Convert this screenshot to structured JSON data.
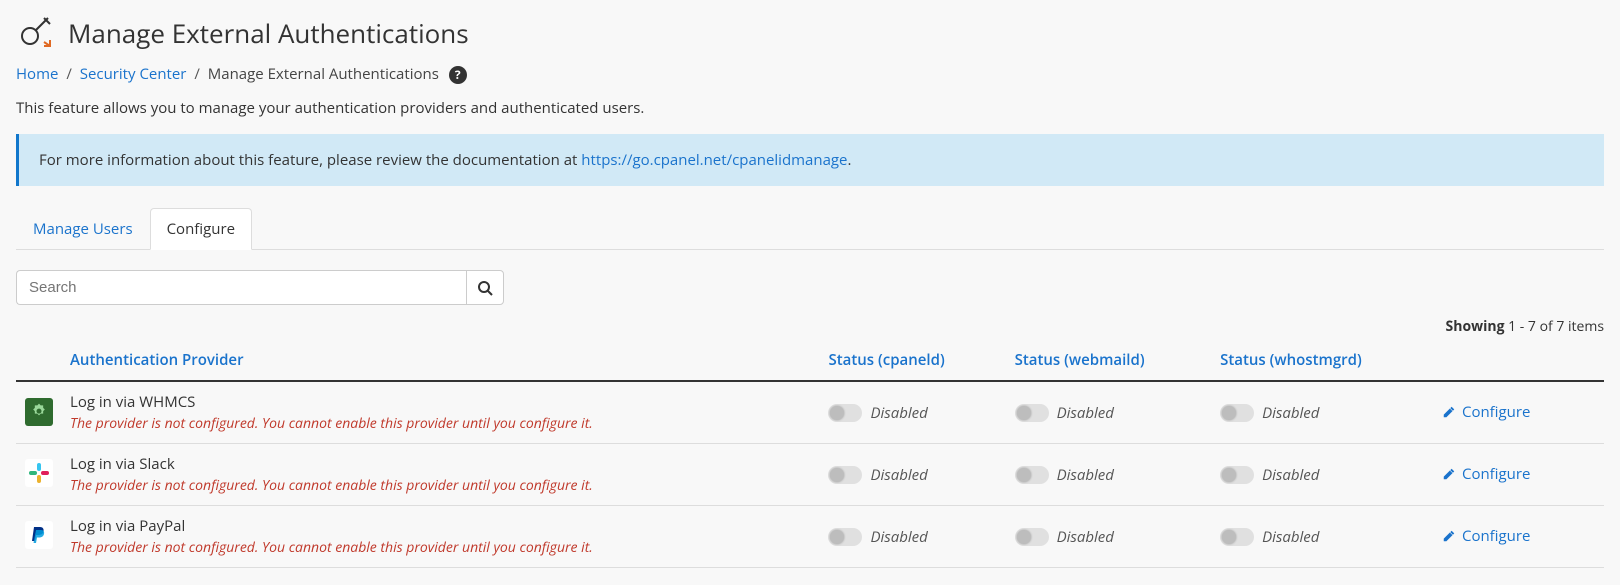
{
  "page": {
    "title": "Manage External Authentications",
    "intro": "This feature allows you to manage your authentication providers and authenticated users."
  },
  "breadcrumbs": {
    "home": "Home",
    "security_center": "Security Center",
    "current": "Manage External Authentications",
    "help_glyph": "?"
  },
  "callout": {
    "prefix": "For more information about this feature, please review the documentation at ",
    "link_text": "https://go.cpanel.net/cpanelidmanage",
    "suffix": "."
  },
  "tabs": {
    "manage_users": "Manage Users",
    "configure": "Configure"
  },
  "search": {
    "placeholder": "Search"
  },
  "showing": {
    "label": "Showing",
    "range": "1 - 7 of 7 items"
  },
  "columns": {
    "provider": "Authentication Provider",
    "status_cpaneld": "Status (cpaneld)",
    "status_webmaild": "Status (webmaild)",
    "status_whostmgrd": "Status (whostmgrd)"
  },
  "status_labels": {
    "disabled": "Disabled"
  },
  "actions": {
    "configure": "Configure"
  },
  "not_configured_message": "The provider is not configured. You cannot enable this provider until you configure it.",
  "providers": [
    {
      "icon": "whmcs-icon",
      "name": "Log in via WHMCS",
      "cpaneld": "disabled",
      "webmaild": "disabled",
      "whostmgrd": "disabled",
      "configured": false
    },
    {
      "icon": "slack-icon",
      "name": "Log in via Slack",
      "cpaneld": "disabled",
      "webmaild": "disabled",
      "whostmgrd": "disabled",
      "configured": false
    },
    {
      "icon": "paypal-icon",
      "name": "Log in via PayPal",
      "cpaneld": "disabled",
      "webmaild": "disabled",
      "whostmgrd": "disabled",
      "configured": false
    }
  ]
}
